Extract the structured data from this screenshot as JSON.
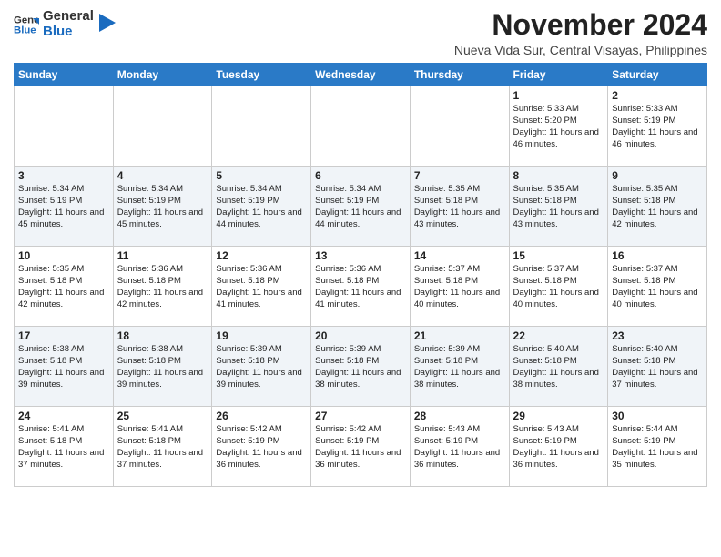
{
  "header": {
    "logo_general": "General",
    "logo_blue": "Blue",
    "month_title": "November 2024",
    "subtitle": "Nueva Vida Sur, Central Visayas, Philippines"
  },
  "weekdays": [
    "Sunday",
    "Monday",
    "Tuesday",
    "Wednesday",
    "Thursday",
    "Friday",
    "Saturday"
  ],
  "weeks": [
    [
      {
        "day": "",
        "info": ""
      },
      {
        "day": "",
        "info": ""
      },
      {
        "day": "",
        "info": ""
      },
      {
        "day": "",
        "info": ""
      },
      {
        "day": "",
        "info": ""
      },
      {
        "day": "1",
        "info": "Sunrise: 5:33 AM\nSunset: 5:20 PM\nDaylight: 11 hours and 46 minutes."
      },
      {
        "day": "2",
        "info": "Sunrise: 5:33 AM\nSunset: 5:19 PM\nDaylight: 11 hours and 46 minutes."
      }
    ],
    [
      {
        "day": "3",
        "info": "Sunrise: 5:34 AM\nSunset: 5:19 PM\nDaylight: 11 hours and 45 minutes."
      },
      {
        "day": "4",
        "info": "Sunrise: 5:34 AM\nSunset: 5:19 PM\nDaylight: 11 hours and 45 minutes."
      },
      {
        "day": "5",
        "info": "Sunrise: 5:34 AM\nSunset: 5:19 PM\nDaylight: 11 hours and 44 minutes."
      },
      {
        "day": "6",
        "info": "Sunrise: 5:34 AM\nSunset: 5:19 PM\nDaylight: 11 hours and 44 minutes."
      },
      {
        "day": "7",
        "info": "Sunrise: 5:35 AM\nSunset: 5:18 PM\nDaylight: 11 hours and 43 minutes."
      },
      {
        "day": "8",
        "info": "Sunrise: 5:35 AM\nSunset: 5:18 PM\nDaylight: 11 hours and 43 minutes."
      },
      {
        "day": "9",
        "info": "Sunrise: 5:35 AM\nSunset: 5:18 PM\nDaylight: 11 hours and 42 minutes."
      }
    ],
    [
      {
        "day": "10",
        "info": "Sunrise: 5:35 AM\nSunset: 5:18 PM\nDaylight: 11 hours and 42 minutes."
      },
      {
        "day": "11",
        "info": "Sunrise: 5:36 AM\nSunset: 5:18 PM\nDaylight: 11 hours and 42 minutes."
      },
      {
        "day": "12",
        "info": "Sunrise: 5:36 AM\nSunset: 5:18 PM\nDaylight: 11 hours and 41 minutes."
      },
      {
        "day": "13",
        "info": "Sunrise: 5:36 AM\nSunset: 5:18 PM\nDaylight: 11 hours and 41 minutes."
      },
      {
        "day": "14",
        "info": "Sunrise: 5:37 AM\nSunset: 5:18 PM\nDaylight: 11 hours and 40 minutes."
      },
      {
        "day": "15",
        "info": "Sunrise: 5:37 AM\nSunset: 5:18 PM\nDaylight: 11 hours and 40 minutes."
      },
      {
        "day": "16",
        "info": "Sunrise: 5:37 AM\nSunset: 5:18 PM\nDaylight: 11 hours and 40 minutes."
      }
    ],
    [
      {
        "day": "17",
        "info": "Sunrise: 5:38 AM\nSunset: 5:18 PM\nDaylight: 11 hours and 39 minutes."
      },
      {
        "day": "18",
        "info": "Sunrise: 5:38 AM\nSunset: 5:18 PM\nDaylight: 11 hours and 39 minutes."
      },
      {
        "day": "19",
        "info": "Sunrise: 5:39 AM\nSunset: 5:18 PM\nDaylight: 11 hours and 39 minutes."
      },
      {
        "day": "20",
        "info": "Sunrise: 5:39 AM\nSunset: 5:18 PM\nDaylight: 11 hours and 38 minutes."
      },
      {
        "day": "21",
        "info": "Sunrise: 5:39 AM\nSunset: 5:18 PM\nDaylight: 11 hours and 38 minutes."
      },
      {
        "day": "22",
        "info": "Sunrise: 5:40 AM\nSunset: 5:18 PM\nDaylight: 11 hours and 38 minutes."
      },
      {
        "day": "23",
        "info": "Sunrise: 5:40 AM\nSunset: 5:18 PM\nDaylight: 11 hours and 37 minutes."
      }
    ],
    [
      {
        "day": "24",
        "info": "Sunrise: 5:41 AM\nSunset: 5:18 PM\nDaylight: 11 hours and 37 minutes."
      },
      {
        "day": "25",
        "info": "Sunrise: 5:41 AM\nSunset: 5:18 PM\nDaylight: 11 hours and 37 minutes."
      },
      {
        "day": "26",
        "info": "Sunrise: 5:42 AM\nSunset: 5:19 PM\nDaylight: 11 hours and 36 minutes."
      },
      {
        "day": "27",
        "info": "Sunrise: 5:42 AM\nSunset: 5:19 PM\nDaylight: 11 hours and 36 minutes."
      },
      {
        "day": "28",
        "info": "Sunrise: 5:43 AM\nSunset: 5:19 PM\nDaylight: 11 hours and 36 minutes."
      },
      {
        "day": "29",
        "info": "Sunrise: 5:43 AM\nSunset: 5:19 PM\nDaylight: 11 hours and 36 minutes."
      },
      {
        "day": "30",
        "info": "Sunrise: 5:44 AM\nSunset: 5:19 PM\nDaylight: 11 hours and 35 minutes."
      }
    ]
  ]
}
